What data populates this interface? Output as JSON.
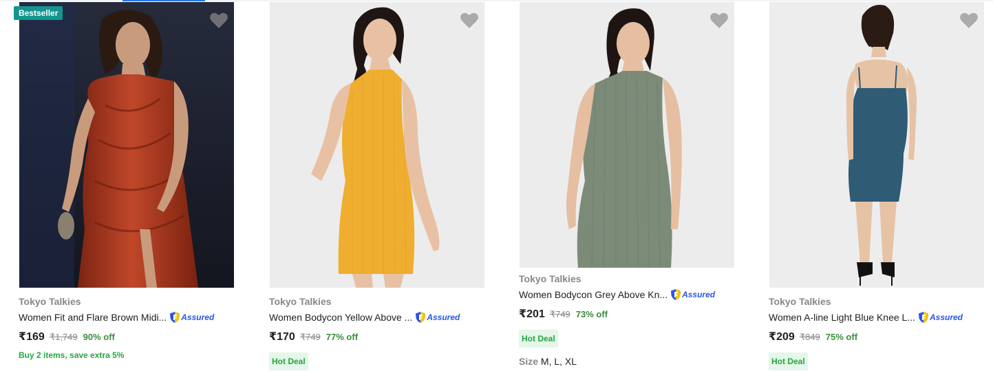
{
  "products": [
    {
      "badge": "Bestseller",
      "brand": "Tokyo Talkies",
      "title": "Women Fit and Flare Brown Midi...",
      "assured": "Assured",
      "price": "₹169",
      "mrp": "₹1,749",
      "discount": "90% off",
      "offer": "Buy 2 items, save extra 5%",
      "image_colors": {
        "bg_top": "#2a2e3d",
        "bg_bottom": "#191c27",
        "dress": "#a9351f",
        "skin": "#c99b7d",
        "hair": "#2b1a12"
      }
    },
    {
      "brand": "Tokyo Talkies",
      "title": "Women Bodycon Yellow Above ...",
      "assured": "Assured",
      "price": "₹170",
      "mrp": "₹749",
      "discount": "77% off",
      "deal": "Hot Deal",
      "image_colors": {
        "bg_top": "#eeeeee",
        "bg_bottom": "#e3e3e3",
        "dress": "#efae2f",
        "skin": "#e8c1a4",
        "hair": "#1f1512"
      }
    },
    {
      "brand": "Tokyo Talkies",
      "title": "Women Bodycon Grey Above Kn...",
      "assured": "Assured",
      "price": "₹201",
      "mrp": "₹749",
      "discount": "73% off",
      "deal": "Hot Deal",
      "sizes_label": "Size",
      "sizes": "M, L, XL",
      "image_colors": {
        "bg_top": "#ededed",
        "bg_bottom": "#e4e4e4",
        "dress": "#7b8b78",
        "skin": "#e6bea1",
        "hair": "#1e1512"
      }
    },
    {
      "brand": "Tokyo Talkies",
      "title": "Women A-line Light Blue Knee L...",
      "assured": "Assured",
      "price": "₹209",
      "mrp": "₹849",
      "discount": "75% off",
      "deal": "Hot Deal",
      "image_colors": {
        "bg_top": "#efefef",
        "bg_bottom": "#e6e6e6",
        "dress": "#2f5b74",
        "skin": "#e7c3a6",
        "hair": "#2a1b14"
      }
    }
  ],
  "icons": {
    "wishlist": "heart-icon",
    "assured": "flipkart-assured-icon"
  },
  "colors": {
    "badge_bg": "#14958f",
    "discount": "#388e3c",
    "offer": "#26a541",
    "hot_deal_bg": "#e4f7e9",
    "assured": "#2a55e5"
  }
}
